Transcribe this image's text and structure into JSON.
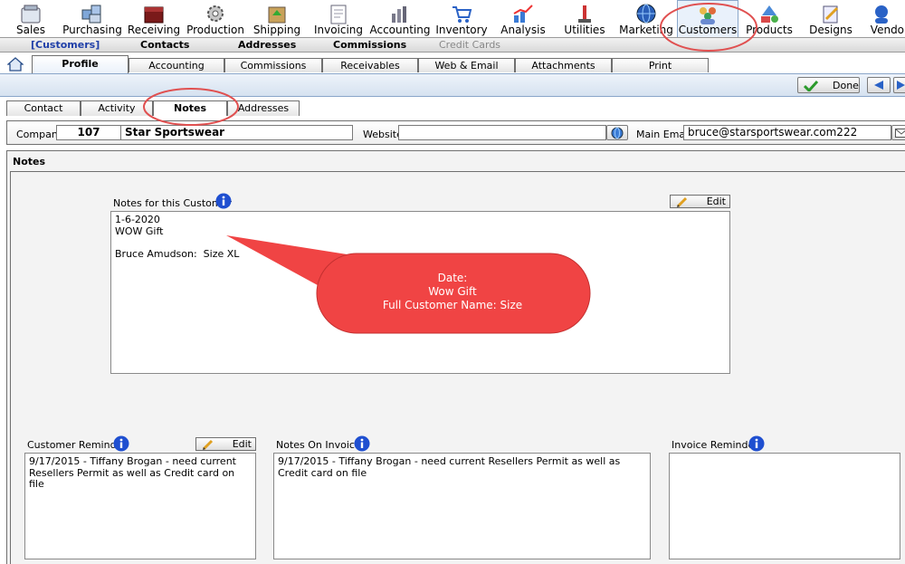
{
  "toolbar": {
    "items": [
      {
        "label": "Sales",
        "icon": "sales-icon"
      },
      {
        "label": "Purchasing",
        "icon": "purchasing-icon"
      },
      {
        "label": "Receiving",
        "icon": "receiving-icon"
      },
      {
        "label": "Production",
        "icon": "production-icon"
      },
      {
        "label": "Shipping",
        "icon": "shipping-icon"
      },
      {
        "label": "Invoicing",
        "icon": "invoicing-icon"
      },
      {
        "label": "Accounting",
        "icon": "accounting-icon"
      },
      {
        "label": "Inventory",
        "icon": "inventory-icon"
      },
      {
        "label": "Analysis",
        "icon": "analysis-icon"
      },
      {
        "label": "Utilities",
        "icon": "utilities-icon"
      },
      {
        "label": "Marketing",
        "icon": "marketing-icon"
      },
      {
        "label": "Customers",
        "icon": "customers-icon"
      },
      {
        "label": "Products",
        "icon": "products-icon"
      },
      {
        "label": "Designs",
        "icon": "designs-icon"
      },
      {
        "label": "Vendors",
        "icon": "vendors-icon"
      }
    ]
  },
  "subnav": {
    "current": "[Customers]",
    "contacts": "Contacts",
    "addresses": "Addresses",
    "commissions": "Commissions",
    "credit_cards": "Credit Cards"
  },
  "maintabs": {
    "profile": "Profile",
    "accounting": "Accounting",
    "commissions": "Commissions",
    "receivables": "Receivables",
    "web_email": "Web & Email",
    "attachments": "Attachments",
    "print": "Print"
  },
  "actionbar": {
    "done": "Done"
  },
  "subtabs": {
    "contact": "Contact",
    "activity": "Activity",
    "notes": "Notes",
    "addresses": "Addresses"
  },
  "company": {
    "company_label": "Company",
    "id": "107",
    "name": "Star Sportswear",
    "website_label": "Website",
    "website": "",
    "email_label": "Main Email",
    "email": "bruce@starsportswear.com222"
  },
  "notes": {
    "section_title": "Notes",
    "customer_notes_label": "Notes for this Customer",
    "customer_notes": "1-6-2020\nWOW Gift\n\nBruce Amudson:  Size XL",
    "edit_label": "Edit",
    "reminder_label": "Customer Reminder",
    "reminder_text": "9/17/2015 - Tiffany Brogan - need current Resellers Permit as well as Credit card on file",
    "on_invoice_label": "Notes On Invoice",
    "on_invoice_text": "9/17/2015 - Tiffany Brogan - need current Resellers Permit as well as Credit card on file",
    "invoice_reminder_label": "Invoice Reminder",
    "invoice_reminder_text": ""
  },
  "callout": {
    "line1": "Date:",
    "line2": "Wow Gift",
    "line3": "Full Customer Name: Size"
  },
  "colors": {
    "callout_fill": "#f04444",
    "highlight_ring": "#e05050",
    "active_text": "#1f3fa8"
  }
}
